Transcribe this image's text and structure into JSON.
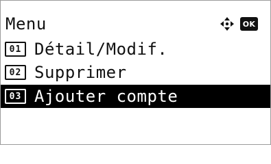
{
  "screen": {
    "title": "Menu",
    "nav_icon": "four-way-arrow-icon",
    "ok_key": "OK"
  },
  "menu": {
    "items": [
      {
        "number": "01",
        "label": "Détail/Modif.",
        "selected": false
      },
      {
        "number": "02",
        "label": "Supprimer",
        "selected": false
      },
      {
        "number": "03",
        "label": "Ajouter compte",
        "selected": true
      }
    ]
  },
  "colors": {
    "foreground": "#111111",
    "highlight_bg": "#000000",
    "highlight_fg": "#ffffff",
    "border": "#9a9a9a"
  }
}
